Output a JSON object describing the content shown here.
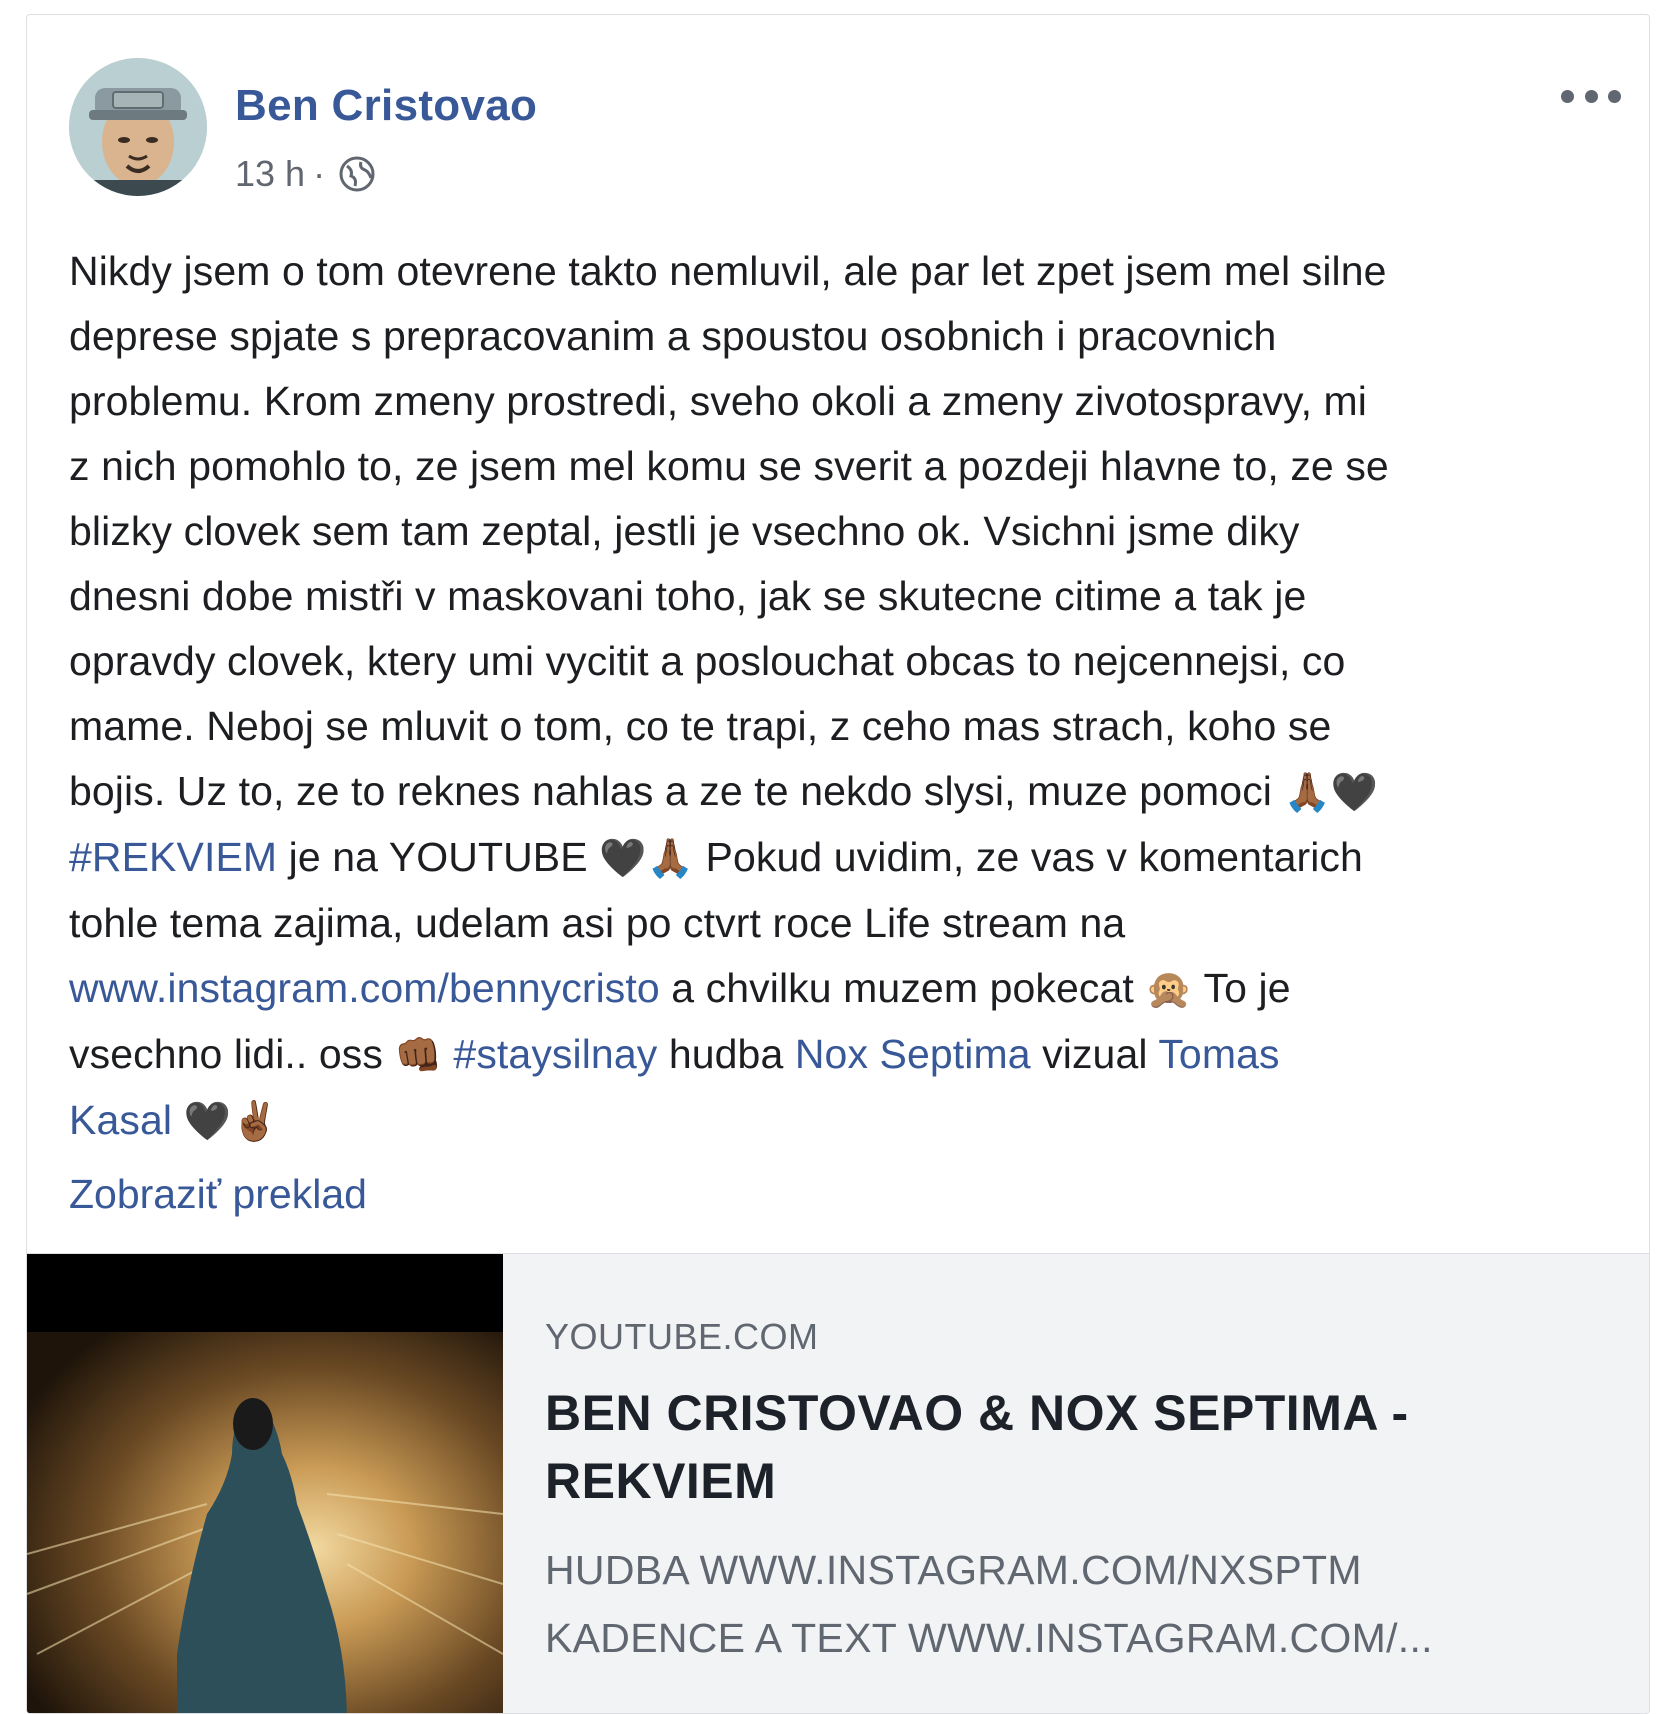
{
  "post": {
    "author": "Ben Cristovao",
    "time": "13 h",
    "separator": "·",
    "lines": [
      "Nikdy jsem o tom otevrene takto nemluvil, ale par let zpet jsem mel silne",
      "deprese spjate s prepracovanim a spoustou osobnich i pracovnich",
      "problemu. Krom zmeny prostredi, sveho okoli a zmeny zivotospravy, mi",
      "z nich pomohlo to, ze jsem mel komu se sverit a pozdeji hlavne to, ze se",
      "blizky clovek sem tam zeptal, jestli je vsechno ok. Vsichni jsme diky",
      "dnesni dobe mistři v maskovani toho, jak se skutecne citime a tak je",
      "opravdy clovek, ktery umi vycitit a poslouchat obcas to nejcennejsi, co",
      "mame. Neboj se mluvit o tom, co te trapi, z ceho mas strach, koho se"
    ],
    "line9_text": "bojis. Uz to, ze to reknes nahlas a ze te nekdo slysi, muze pomoci ",
    "emoji_pray": "🙏🏾",
    "emoji_heart": "🖤",
    "hashtag_rekviem": "#REKVIEM",
    "line10_text": " je na YOUTUBE ",
    "line10_rest": " Pokud uvidim, ze vas v komentarich",
    "line11_text": "tohle tema zajima, udelam asi po ctvrt roce Life stream na",
    "instagram_link": "www.instagram.com/bennycristo",
    "line12_text": " a chvilku muzem pokecat ",
    "emoji_monkey": "🙊",
    "line12_rest": " To je",
    "line13_text": "vsechno lidi.. oss ",
    "emoji_fist": "👊🏾",
    "hashtag_stay": "#staysilnay",
    "line13_mid": " hudba ",
    "link_nox": "Nox Septima",
    "line13_mid2": " vizual ",
    "link_tomas_1": "Tomas",
    "link_tomas_2": "Kasal",
    "emoji_peace": "✌🏾",
    "translate_label": "Zobraziť preklad"
  },
  "link_preview": {
    "domain": "YOUTUBE.COM",
    "title": "BEN CRISTOVAO & NOX SEPTIMA - REKVIEM",
    "desc_lines": [
      "HUDBA WWW.INSTAGRAM.COM/NXSPTM",
      "KADENCE A TEXT WWW.INSTAGRAM.COM/..."
    ]
  },
  "colors": {
    "link": "#385898",
    "text": "#1c1e21",
    "meta": "#616770",
    "preview_bg": "#f2f3f5"
  },
  "icons": [
    "globe-icon",
    "more-options-icon"
  ]
}
